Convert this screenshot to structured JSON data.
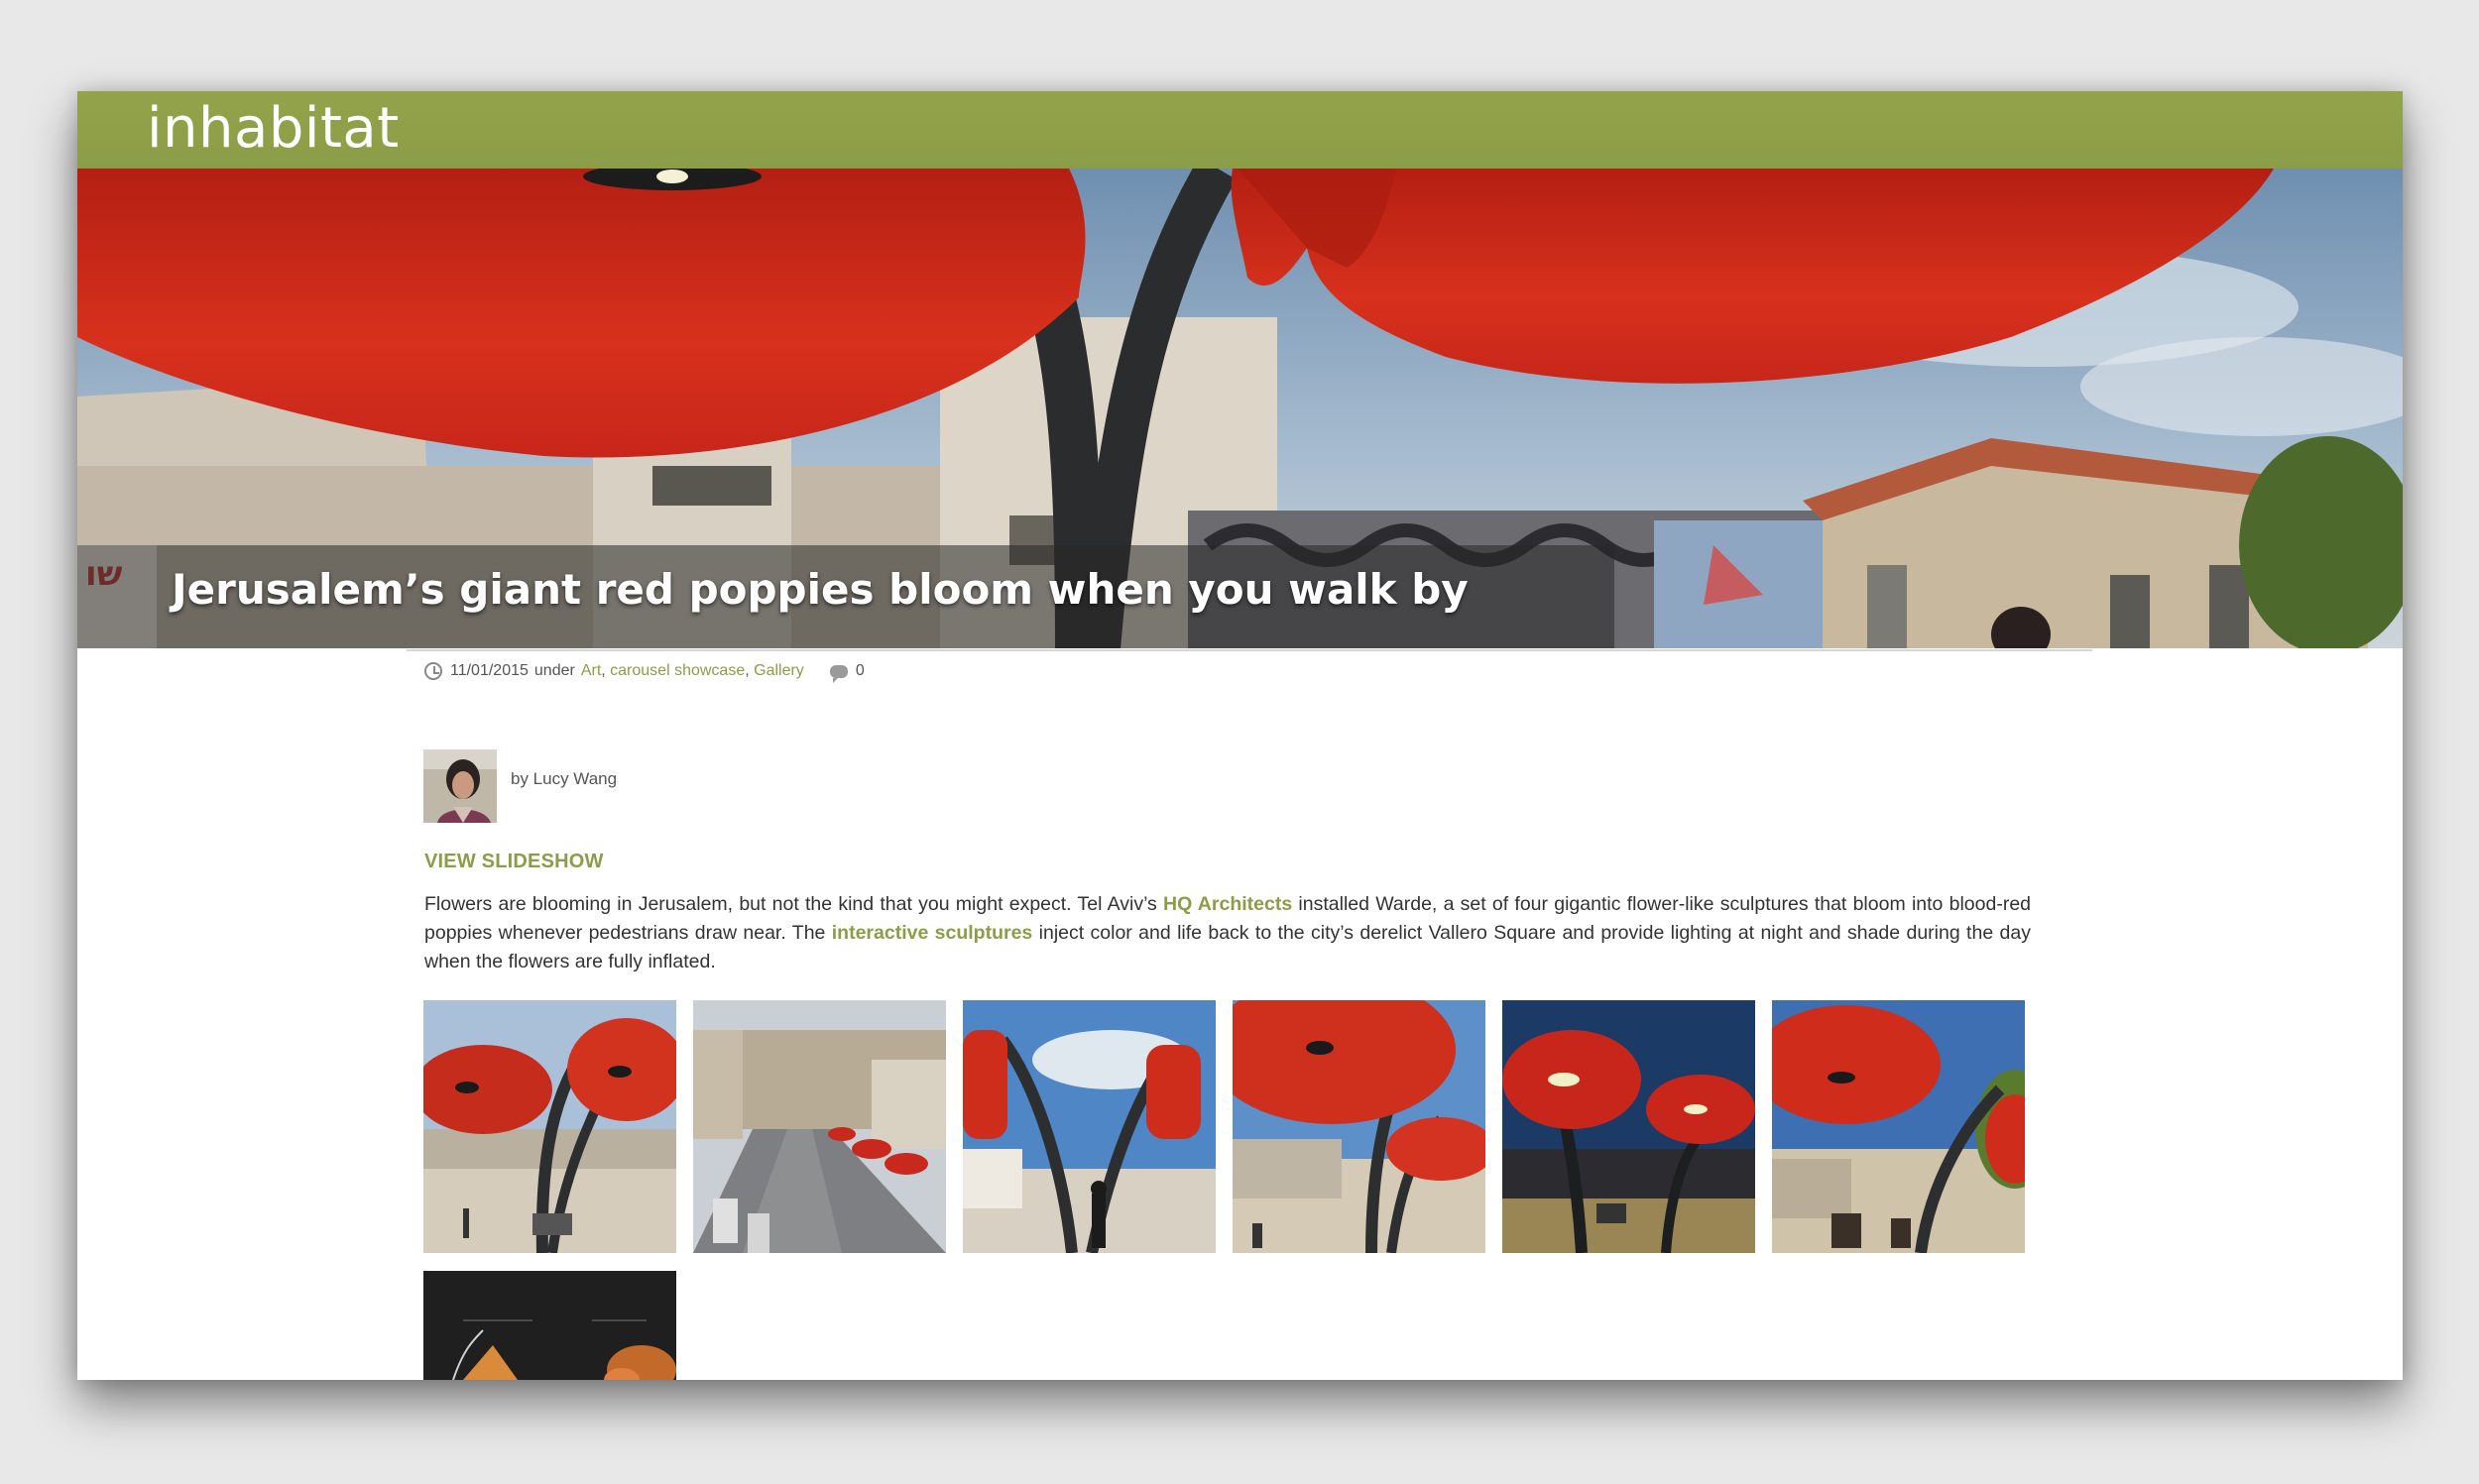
{
  "site": {
    "logo": "inhabitat",
    "brand_color": "#8c9d47"
  },
  "hero": {
    "title": "Jerusalem’s giant red poppies bloom when you walk by"
  },
  "meta": {
    "date": "11/01/2015",
    "under_label": "under",
    "categories": [
      "Art",
      "carousel showcase",
      "Gallery"
    ],
    "comment_count": "0",
    "icons": [
      "clock-icon",
      "comment-icon"
    ]
  },
  "author": {
    "byline": "by Lucy Wang"
  },
  "view_slideshow": "VIEW SLIDESHOW",
  "article": {
    "part1": "Flowers are blooming in Jerusalem, but not the kind that you might expect. Tel Aviv’s ",
    "link1": "HQ Architects",
    "part2": " installed Warde, a set of four gigantic flower-like sculptures that bloom into blood-red poppies whenever pedestrians draw near. The ",
    "link2": "interactive sculptures",
    "part3": " inject color and life back to the city’s derelict Vallero Square and provide lighting at night and shade during the day when the flowers are fully inflated."
  },
  "gallery": {
    "thumbnails": [
      {
        "name": "gallery-thumb-1"
      },
      {
        "name": "gallery-thumb-2"
      },
      {
        "name": "gallery-thumb-3"
      },
      {
        "name": "gallery-thumb-4"
      },
      {
        "name": "gallery-thumb-5"
      },
      {
        "name": "gallery-thumb-6"
      },
      {
        "name": "gallery-thumb-7"
      }
    ]
  }
}
